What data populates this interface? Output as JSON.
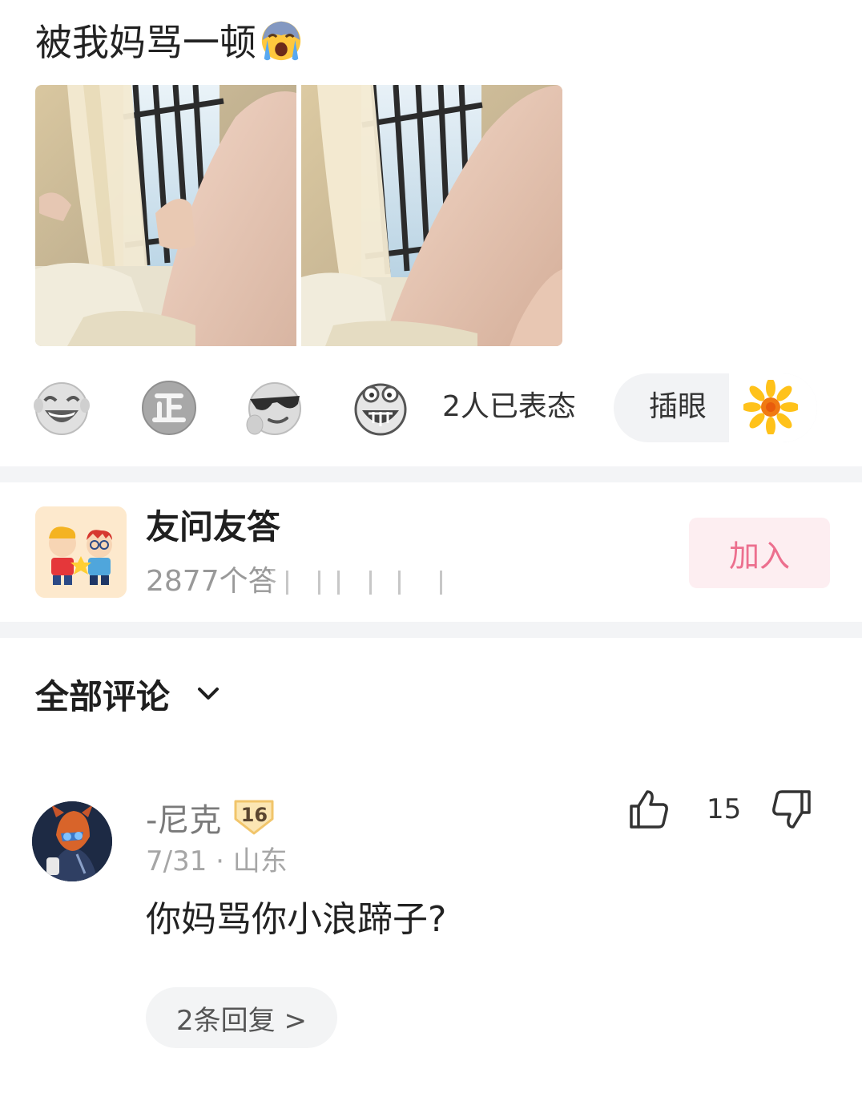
{
  "post": {
    "title": "被我妈骂一顿",
    "title_emoji": "crying-face-icon",
    "images": [
      {
        "alt": "photo-curtain-window-leg-1"
      },
      {
        "alt": "photo-curtain-window-leg-2"
      }
    ]
  },
  "reactions": {
    "icons": [
      "laughing-face-icon",
      "zheng-badge-icon",
      "cool-sunglasses-face-icon",
      "grimace-face-icon"
    ],
    "count_text": "2人已表态",
    "pill_label": "插眼",
    "pill_icon": "sunflower-icon"
  },
  "group": {
    "name": "友问友答",
    "stats": "2877个答",
    "join_label": "加入",
    "accent": "#ec6f8e"
  },
  "comments_section": {
    "sort_label": "全部评论"
  },
  "comments": [
    {
      "username": "-尼克",
      "level": "16",
      "meta": "7/31 · 山东",
      "text": "你妈骂你小浪蹄子?",
      "likes": "15",
      "replies_label": "2条回复 >"
    }
  ]
}
